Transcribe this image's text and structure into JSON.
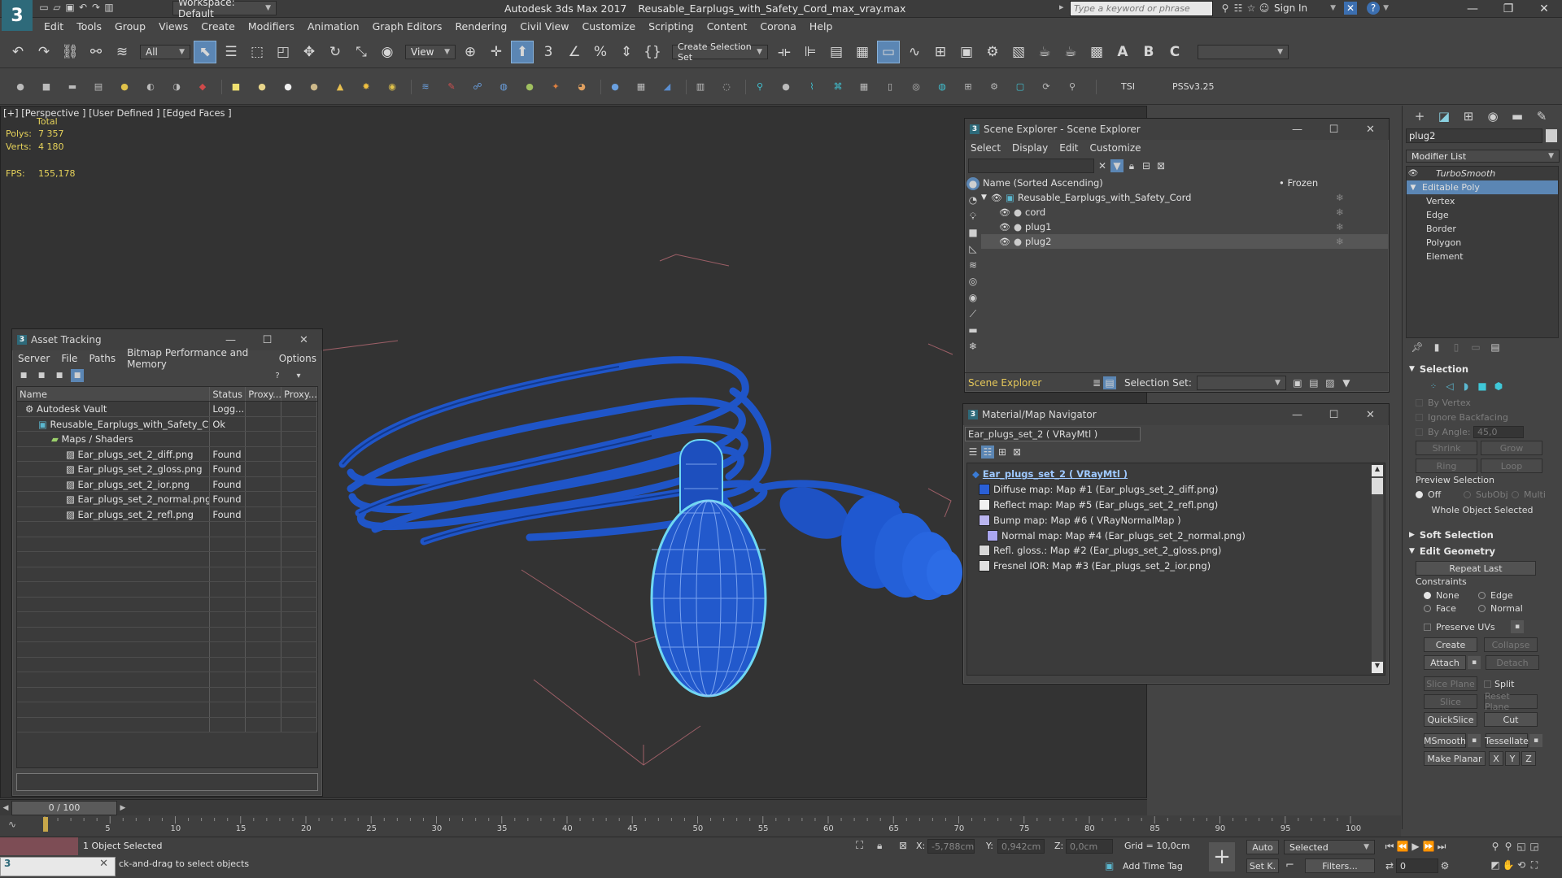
{
  "window": {
    "title": "Autodesk 3ds Max 2017",
    "file": "Reusable_Earplugs_with_Safety_Cord_max_vray.max",
    "workspace": "Workspace: Default",
    "search_placeholder": "Type a keyword or phrase",
    "sign_in": "Sign In"
  },
  "menubar": [
    "Edit",
    "Tools",
    "Group",
    "Views",
    "Create",
    "Modifiers",
    "Animation",
    "Graph Editors",
    "Rendering",
    "Civil View",
    "Customize",
    "Scripting",
    "Content",
    "Corona",
    "Help"
  ],
  "toolbar": {
    "filter": "All",
    "ref_coord": "View",
    "selection_set": "Create Selection Set",
    "tsi": "TSI",
    "pssv": "PSSv3.25"
  },
  "viewport": {
    "label": "[+] [Perspective ]  [User Defined ]  [Edged Faces ]",
    "total": "Total",
    "polys_label": "Polys:",
    "polys": "7 357",
    "verts_label": "Verts:",
    "verts": "4 180",
    "fps_label": "FPS:",
    "fps": "155,178"
  },
  "asset_tracking": {
    "title": "Asset Tracking",
    "menu": [
      "Server",
      "File",
      "Paths",
      "Bitmap Performance and Memory",
      "Options"
    ],
    "columns": [
      "Name",
      "Status",
      "Proxy...",
      "Proxy..."
    ],
    "rows": [
      {
        "name": "Autodesk Vault",
        "status": "Logg..."
      },
      {
        "name": "Reusable_Earplugs_with_Safety_Co...",
        "status": "Ok"
      },
      {
        "name": "Maps / Shaders",
        "status": ""
      },
      {
        "name": "Ear_plugs_set_2_diff.png",
        "status": "Found"
      },
      {
        "name": "Ear_plugs_set_2_gloss.png",
        "status": "Found"
      },
      {
        "name": "Ear_plugs_set_2_ior.png",
        "status": "Found"
      },
      {
        "name": "Ear_plugs_set_2_normal.png",
        "status": "Found"
      },
      {
        "name": "Ear_plugs_set_2_refl.png",
        "status": "Found"
      }
    ]
  },
  "scene_explorer": {
    "title": "Scene Explorer - Scene Explorer",
    "menu": [
      "Select",
      "Display",
      "Edit",
      "Customize"
    ],
    "col_name": "Name (Sorted Ascending)",
    "col_frozen": "• Frozen",
    "items": [
      "Reusable_Earplugs_with_Safety_Cord",
      "cord",
      "plug1",
      "plug2"
    ],
    "footer_label": "Scene Explorer",
    "selection_set_label": "Selection Set:"
  },
  "material_navigator": {
    "title": "Material/Map Navigator",
    "current": "Ear_plugs_set_2  ( VRayMtl )",
    "root": "Ear_plugs_set_2  ( VRayMtl )",
    "maps": [
      {
        "label": "Diffuse map: Map #1 (Ear_plugs_set_2_diff.png)",
        "color": "#2a5fd6"
      },
      {
        "label": "Reflect map: Map #5 (Ear_plugs_set_2_refl.png)",
        "color": "#f2f2f2"
      },
      {
        "label": "Bump map: Map #6  ( VRayNormalMap )",
        "color": "#b9b4ee"
      },
      {
        "label": "Normal map: Map #4 (Ear_plugs_set_2_normal.png)",
        "color": "#aaa6f0"
      },
      {
        "label": "Refl. gloss.: Map #2 (Ear_plugs_set_2_gloss.png)",
        "color": "#d8d8d8"
      },
      {
        "label": "Fresnel IOR: Map #3 (Ear_plugs_set_2_ior.png)",
        "color": "#e0e0e0"
      }
    ]
  },
  "command_panel": {
    "object_name": "plug2",
    "modifier_list": "Modifier List",
    "stack": [
      "TurboSmooth",
      "Editable Poly",
      "Vertex",
      "Edge",
      "Border",
      "Polygon",
      "Element"
    ],
    "selection": {
      "title": "Selection",
      "by_vertex": "By Vertex",
      "ignore_backfacing": "Ignore Backfacing",
      "by_angle": "By Angle:",
      "angle_value": "45,0",
      "shrink": "Shrink",
      "grow": "Grow",
      "ring": "Ring",
      "loop": "Loop",
      "preview_selection": "Preview Selection",
      "off": "Off",
      "subobj": "SubObj",
      "multi": "Multi",
      "status": "Whole Object Selected"
    },
    "soft_selection": "Soft Selection",
    "edit_geometry": {
      "title": "Edit Geometry",
      "repeat_last": "Repeat Last",
      "constraints": "Constraints",
      "none": "None",
      "edge": "Edge",
      "face": "Face",
      "normal": "Normal",
      "preserve_uvs": "Preserve UVs",
      "create": "Create",
      "collapse": "Collapse",
      "attach": "Attach",
      "detach": "Detach",
      "slice_plane": "Slice Plane",
      "split": "Split",
      "slice": "Slice",
      "reset_plane": "Reset Plane",
      "quickslice": "QuickSlice",
      "cut": "Cut",
      "msmooth": "MSmooth",
      "tessellate": "Tessellate",
      "make_planar": "Make Planar",
      "x": "X",
      "y": "Y",
      "z": "Z"
    }
  },
  "timeline": {
    "frame": "0 / 100",
    "ticks": [
      "5",
      "10",
      "15",
      "20",
      "25",
      "30",
      "35",
      "40",
      "45",
      "50",
      "55",
      "60",
      "65",
      "70",
      "75",
      "80",
      "85",
      "90",
      "95",
      "100"
    ]
  },
  "status_bar": {
    "selected": "1 Object Selected",
    "prompt": "ck-and-drag to select objects",
    "x_label": "X:",
    "x": "-5,788cm",
    "y_label": "Y:",
    "y": "0,942cm",
    "z_label": "Z:",
    "z": "0,0cm",
    "grid": "Grid = 10,0cm",
    "add_time_tag": "Add Time Tag",
    "auto": "Auto",
    "selected_mode": "Selected",
    "set_k": "Set K.",
    "filters": "Filters...",
    "frame_field": "0"
  }
}
